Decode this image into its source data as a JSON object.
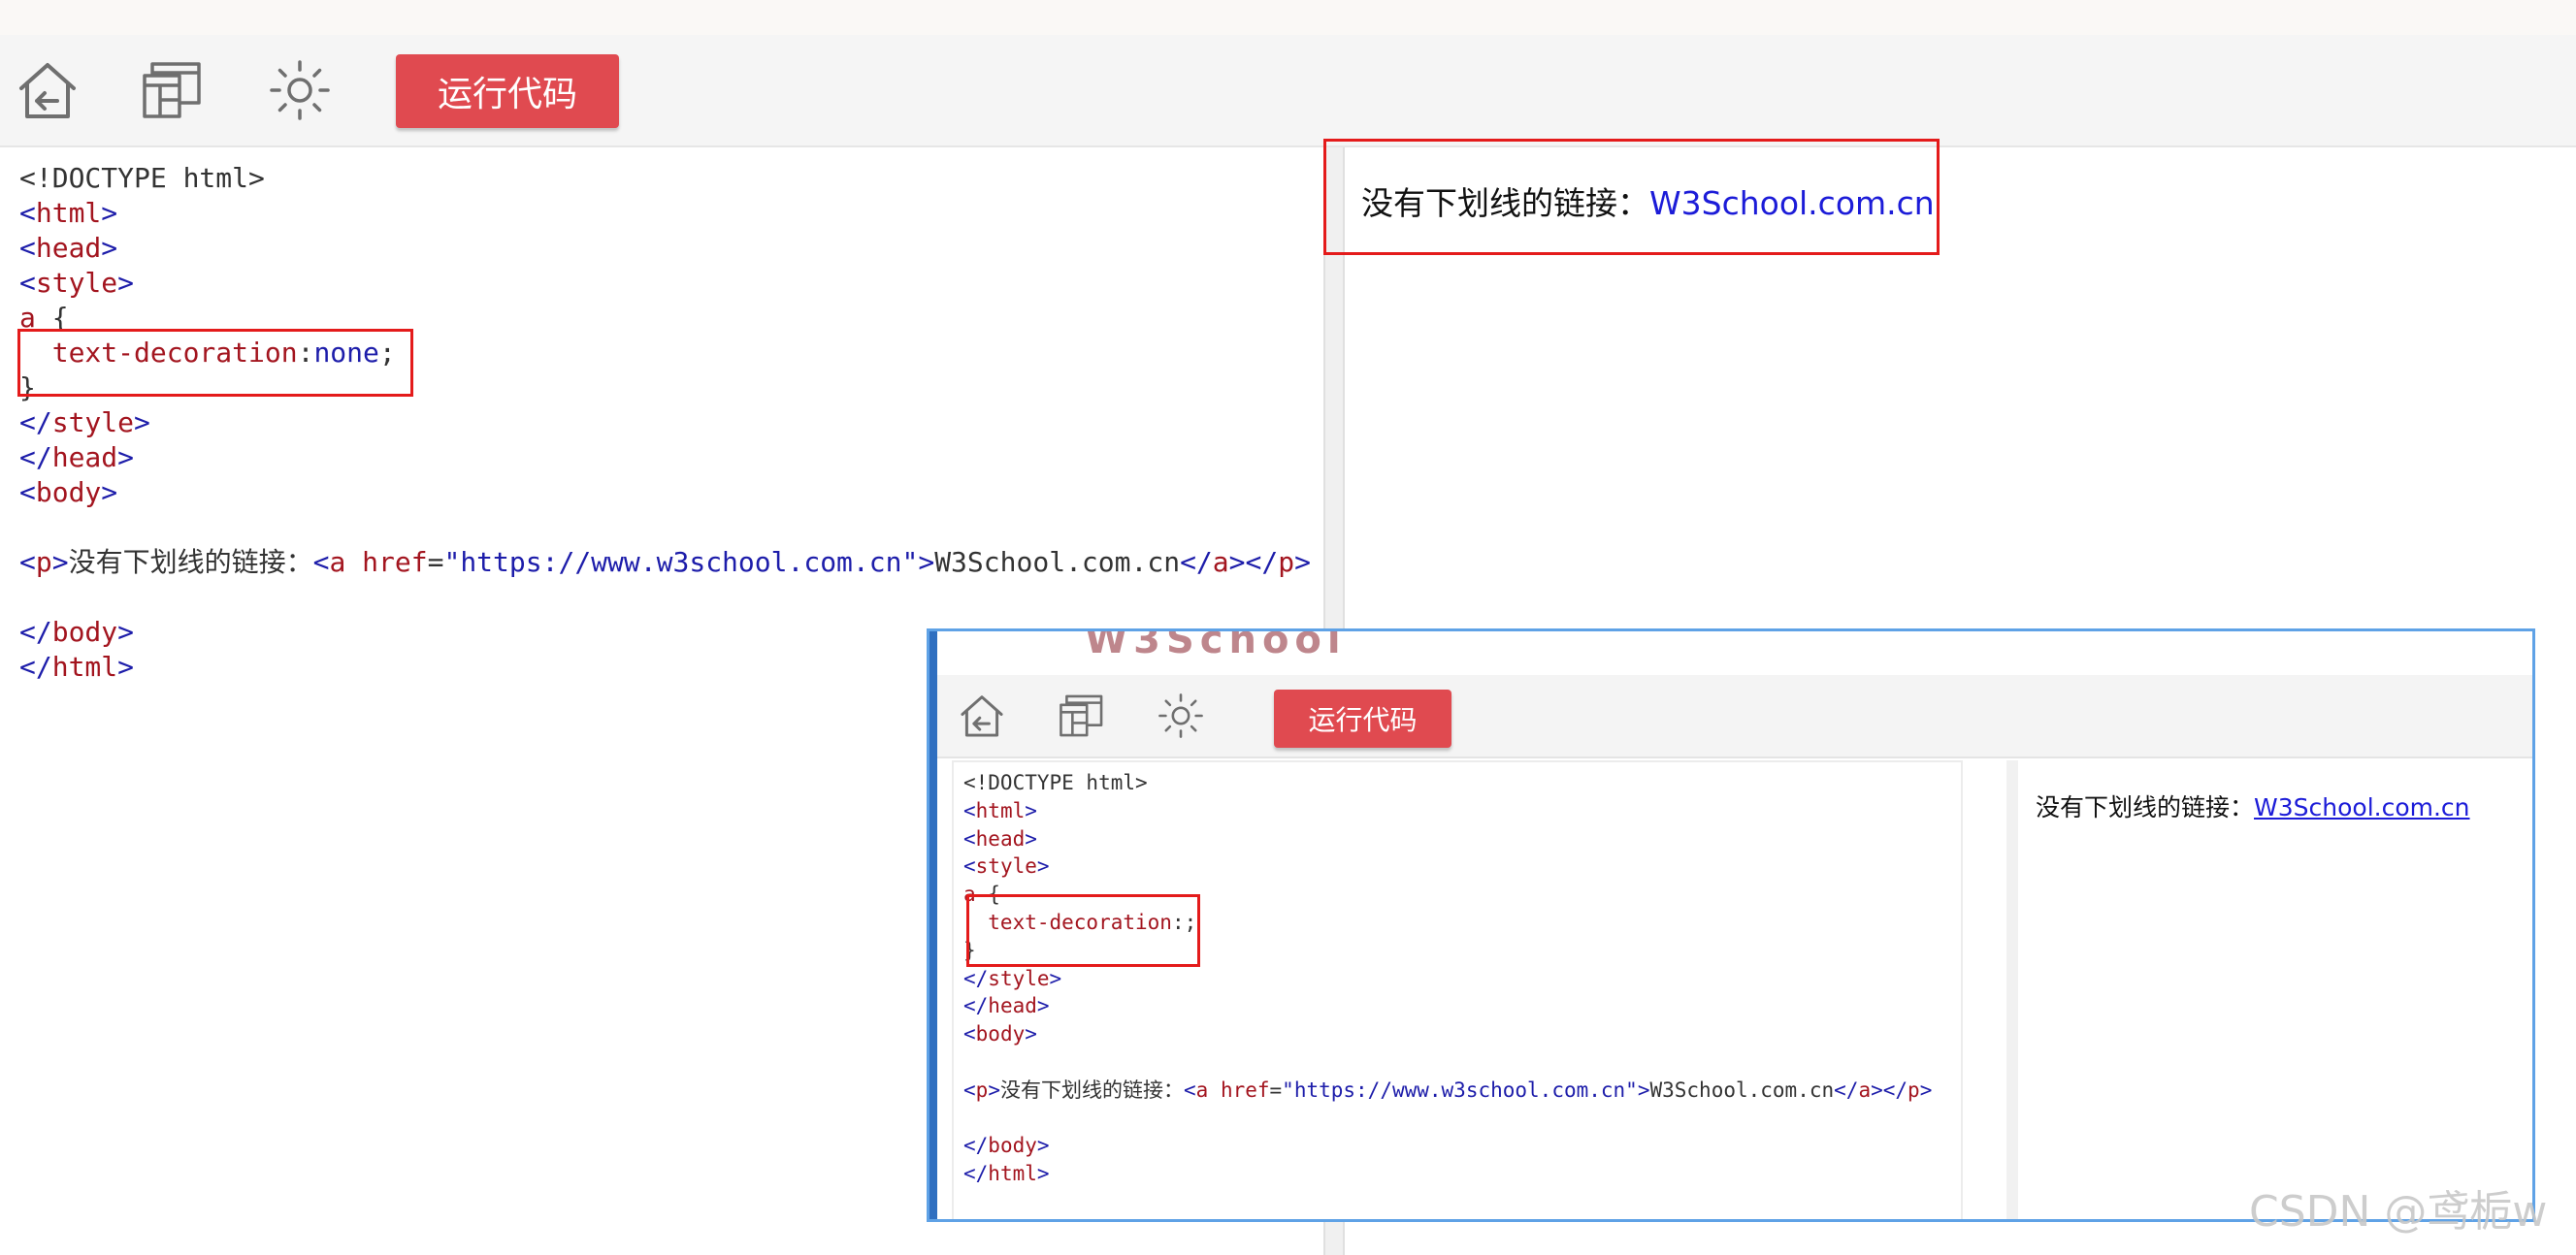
{
  "toolbar": {
    "icons": [
      "home-icon",
      "windows-icon",
      "brightness-icon"
    ],
    "run_label": "运行代码"
  },
  "editor": {
    "lines": [
      [
        {
          "t": "<!DOCTYPE html>",
          "c": ""
        }
      ],
      [
        {
          "t": "<",
          "c": "t"
        },
        {
          "t": "html",
          "c": "e"
        },
        {
          "t": ">",
          "c": "t"
        }
      ],
      [
        {
          "t": "<",
          "c": "t"
        },
        {
          "t": "head",
          "c": "e"
        },
        {
          "t": ">",
          "c": "t"
        }
      ],
      [
        {
          "t": "<",
          "c": "t"
        },
        {
          "t": "style",
          "c": "e"
        },
        {
          "t": ">",
          "c": "t"
        }
      ],
      [
        {
          "t": "a",
          "c": "e"
        },
        {
          "t": " {",
          "c": ""
        }
      ],
      [
        {
          "t": "  text-decoration",
          "c": "e"
        },
        {
          "t": ":",
          "c": ""
        },
        {
          "t": "none",
          "c": "v"
        },
        {
          "t": ";",
          "c": ""
        }
      ],
      [
        {
          "t": "}",
          "c": ""
        }
      ],
      [
        {
          "t": "</",
          "c": "t"
        },
        {
          "t": "style",
          "c": "e"
        },
        {
          "t": ">",
          "c": "t"
        }
      ],
      [
        {
          "t": "</",
          "c": "t"
        },
        {
          "t": "head",
          "c": "e"
        },
        {
          "t": ">",
          "c": "t"
        }
      ],
      [
        {
          "t": "<",
          "c": "t"
        },
        {
          "t": "body",
          "c": "e"
        },
        {
          "t": ">",
          "c": "t"
        }
      ],
      [],
      [
        {
          "t": "<",
          "c": "t"
        },
        {
          "t": "p",
          "c": "e"
        },
        {
          "t": ">",
          "c": "t"
        },
        {
          "t": "没有下划线的链接：",
          "c": ""
        },
        {
          "t": "<",
          "c": "t"
        },
        {
          "t": "a",
          "c": "e"
        },
        {
          "t": " ",
          "c": ""
        },
        {
          "t": "href",
          "c": "e"
        },
        {
          "t": "=",
          "c": ""
        },
        {
          "t": "\"https://www.w3school.com.cn\"",
          "c": "v"
        },
        {
          "t": ">",
          "c": "t"
        },
        {
          "t": "W3School.com.cn",
          "c": ""
        },
        {
          "t": "</",
          "c": "t"
        },
        {
          "t": "a",
          "c": "e"
        },
        {
          "t": ">",
          "c": "t"
        },
        {
          "t": "</",
          "c": "t"
        },
        {
          "t": "p",
          "c": "e"
        },
        {
          "t": ">",
          "c": "t"
        }
      ],
      [],
      [
        {
          "t": "</",
          "c": "t"
        },
        {
          "t": "body",
          "c": "e"
        },
        {
          "t": ">",
          "c": "t"
        }
      ],
      [
        {
          "t": "</",
          "c": "t"
        },
        {
          "t": "html",
          "c": "e"
        },
        {
          "t": ">",
          "c": "t"
        }
      ]
    ]
  },
  "result": {
    "label": "没有下划线的链接：",
    "link": "W3School.com.cn"
  },
  "inset": {
    "logo_fragment": "W3School",
    "run_label": "运行代码",
    "editor_lines": [
      [
        {
          "t": "<!DOCTYPE html>",
          "c": ""
        }
      ],
      [
        {
          "t": "<",
          "c": "t"
        },
        {
          "t": "html",
          "c": "e"
        },
        {
          "t": ">",
          "c": "t"
        }
      ],
      [
        {
          "t": "<",
          "c": "t"
        },
        {
          "t": "head",
          "c": "e"
        },
        {
          "t": ">",
          "c": "t"
        }
      ],
      [
        {
          "t": "<",
          "c": "t"
        },
        {
          "t": "style",
          "c": "e"
        },
        {
          "t": ">",
          "c": "t"
        }
      ],
      [
        {
          "t": "a",
          "c": "e"
        },
        {
          "t": " {",
          "c": ""
        }
      ],
      [
        {
          "t": "  text-decoration",
          "c": "e"
        },
        {
          "t": ":;",
          "c": ""
        }
      ],
      [
        {
          "t": "}",
          "c": ""
        }
      ],
      [
        {
          "t": "</",
          "c": "t"
        },
        {
          "t": "style",
          "c": "e"
        },
        {
          "t": ">",
          "c": "t"
        }
      ],
      [
        {
          "t": "</",
          "c": "t"
        },
        {
          "t": "head",
          "c": "e"
        },
        {
          "t": ">",
          "c": "t"
        }
      ],
      [
        {
          "t": "<",
          "c": "t"
        },
        {
          "t": "body",
          "c": "e"
        },
        {
          "t": ">",
          "c": "t"
        }
      ],
      [],
      [
        {
          "t": "<",
          "c": "t"
        },
        {
          "t": "p",
          "c": "e"
        },
        {
          "t": ">",
          "c": "t"
        },
        {
          "t": "没有下划线的链接：",
          "c": ""
        },
        {
          "t": "<",
          "c": "t"
        },
        {
          "t": "a",
          "c": "e"
        },
        {
          "t": " ",
          "c": ""
        },
        {
          "t": "href",
          "c": "e"
        },
        {
          "t": "=",
          "c": ""
        },
        {
          "t": "\"https://www.w3school.com.cn\"",
          "c": "v"
        },
        {
          "t": ">",
          "c": "t"
        },
        {
          "t": "W3School.com.cn",
          "c": ""
        },
        {
          "t": "</",
          "c": "t"
        },
        {
          "t": "a",
          "c": "e"
        },
        {
          "t": ">",
          "c": "t"
        },
        {
          "t": "</",
          "c": "t"
        },
        {
          "t": "p",
          "c": "e"
        },
        {
          "t": ">",
          "c": "t"
        }
      ],
      [],
      [
        {
          "t": "</",
          "c": "t"
        },
        {
          "t": "body",
          "c": "e"
        },
        {
          "t": ">",
          "c": "t"
        }
      ],
      [
        {
          "t": "</",
          "c": "t"
        },
        {
          "t": "html",
          "c": "e"
        },
        {
          "t": ">",
          "c": "t"
        }
      ]
    ],
    "result_label": "没有下划线的链接：",
    "result_link": "W3School.com.cn"
  },
  "watermark": "CSDN @鸢栀w",
  "colors": {
    "run_button": "#e04a50",
    "highlight_box": "#e41b1b",
    "link": "#1c1cd8",
    "tag": "#1d1daa",
    "element": "#a3151f",
    "inset_border": "#5fa2e6"
  }
}
